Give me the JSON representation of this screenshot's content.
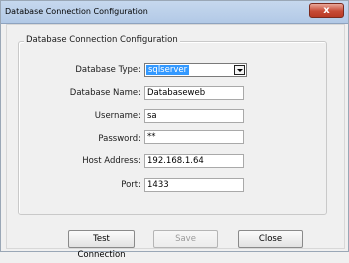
{
  "window": {
    "title": "Database Connection Configuration",
    "close_glyph": "x"
  },
  "group": {
    "legend": "Database Connection Configuration"
  },
  "form": {
    "database_type": {
      "label": "Database Type:",
      "value": "sqlserver"
    },
    "database_name": {
      "label": "Database Name:",
      "value": "Databaseweb"
    },
    "username": {
      "label": "Username:",
      "value": "sa"
    },
    "password": {
      "label": "Password:",
      "value": "**"
    },
    "host_address": {
      "label": "Host Address:",
      "value": "192.168.1.64"
    },
    "port": {
      "label": "Port:",
      "value": "1433"
    }
  },
  "buttons": {
    "test_connection": "Test Connection",
    "save": "Save",
    "close": "Close"
  },
  "colors": {
    "selection": "#3399ff",
    "close_button": "#c74b36"
  }
}
